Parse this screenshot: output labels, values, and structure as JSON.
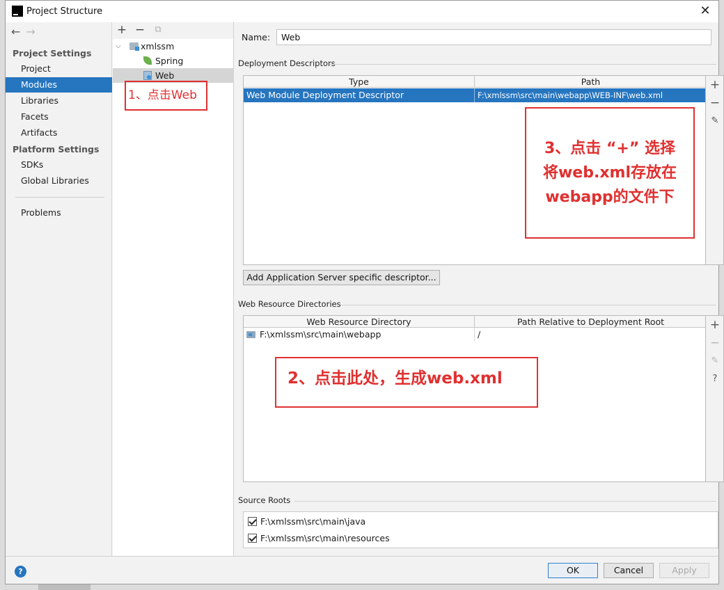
{
  "window": {
    "title": "Project Structure",
    "app_icon_letter": "IJ",
    "close_glyph": "✕"
  },
  "nav": {
    "back": "←",
    "forward": "→"
  },
  "sidebar": {
    "project_settings_header": "Project Settings",
    "project_items": [
      {
        "label": "Project"
      },
      {
        "label": "Modules",
        "selected": true
      },
      {
        "label": "Libraries"
      },
      {
        "label": "Facets"
      },
      {
        "label": "Artifacts"
      }
    ],
    "platform_settings_header": "Platform Settings",
    "platform_items": [
      {
        "label": "SDKs"
      },
      {
        "label": "Global Libraries"
      }
    ],
    "problems_label": "Problems"
  },
  "tree": {
    "toolbar": {
      "add": "+",
      "remove": "−",
      "copy": "⧉"
    },
    "root": "xmlssm",
    "children": [
      "Spring",
      "Web"
    ],
    "selected": "Web"
  },
  "annotations": {
    "step1": "1、点击Web",
    "step2": "2、点击此处，生成web.xml",
    "step3_line1": "3、点击 “+” 选择",
    "step3_line2": "将web.xml存放在",
    "step3_line3": "webapp的文件下"
  },
  "main": {
    "name_label": "Name:",
    "name_value": "Web",
    "deployment": {
      "section_title": "Deployment Descriptors",
      "columns": [
        "Type",
        "Path"
      ],
      "rows": [
        {
          "type": "Web Module Deployment Descriptor",
          "path": "F:\\xmlssm\\src\\main\\webapp\\WEB-INF\\web.xml"
        }
      ],
      "buttons": {
        "add": "+",
        "remove": "−",
        "edit": "✎"
      }
    },
    "add_server_button": "Add Application Server specific descriptor...",
    "web_resource": {
      "section_title": "Web Resource Directories",
      "columns": [
        "Web Resource Directory",
        "Path Relative to Deployment Root"
      ],
      "rows": [
        {
          "directory": "F:\\xmlssm\\src\\main\\webapp",
          "relative": "/"
        }
      ],
      "buttons": {
        "add": "+",
        "remove": "−",
        "edit": "✎",
        "help": "?"
      }
    },
    "source_roots": {
      "section_title": "Source Roots",
      "items": [
        {
          "label": "F:\\xmlssm\\src\\main\\java",
          "checked": true
        },
        {
          "label": "F:\\xmlssm\\src\\main\\resources",
          "checked": true
        }
      ]
    }
  },
  "footer": {
    "help": "?",
    "ok": "OK",
    "cancel": "Cancel",
    "apply": "Apply"
  },
  "colors": {
    "selection": "#2675bf",
    "annotation": "#e03030",
    "window_bg": "#f2f2f2"
  }
}
